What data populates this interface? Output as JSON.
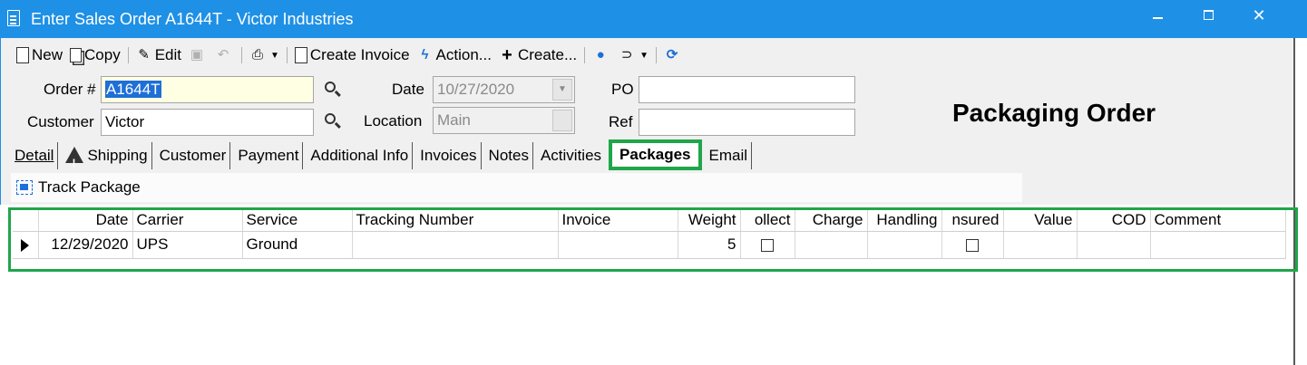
{
  "window": {
    "title": "Enter Sales Order A1644T - Victor Industries",
    "minimize_icon": "minimize-icon",
    "maximize_icon": "maximize-icon",
    "close_icon": "close-icon",
    "close_glyph": "✕",
    "accent_color": "#1e90e6"
  },
  "toolbar": {
    "new_label": "New",
    "copy_label": "Copy",
    "edit_label": "Edit",
    "create_invoice_label": "Create Invoice",
    "action_label": "Action...",
    "create_label": "Create...",
    "icons": [
      "new-document-icon",
      "copy-icon",
      "pencil-icon",
      "save-icon",
      "undo-icon",
      "printer-icon",
      "invoice-icon",
      "lightning-icon",
      "plus-icon",
      "contacts-icon",
      "paperclip-icon",
      "refresh-icon"
    ]
  },
  "form": {
    "order_label": "Order #",
    "order_value": "A1644T",
    "customer_label": "Customer",
    "customer_value": "Victor",
    "date_label": "Date",
    "date_value": "10/27/2020",
    "location_label": "Location",
    "location_value": "Main",
    "po_label": "PO",
    "po_value": "",
    "ref_label": "Ref",
    "ref_value": ""
  },
  "heading": "Packaging Order",
  "tabs": [
    {
      "label": "Detail",
      "active": false
    },
    {
      "label": "Shipping",
      "active": false,
      "icon": "warning-icon"
    },
    {
      "label": "Customer",
      "active": false
    },
    {
      "label": "Payment",
      "active": false
    },
    {
      "label": "Additional Info",
      "active": false
    },
    {
      "label": "Invoices",
      "active": false
    },
    {
      "label": "Notes",
      "active": false
    },
    {
      "label": "Activities",
      "active": false
    },
    {
      "label": "Packages",
      "active": true
    },
    {
      "label": "Email",
      "active": false
    }
  ],
  "subtoolbar": {
    "track_package_label": "Track Package"
  },
  "grid": {
    "columns": [
      "Date",
      "Carrier",
      "Service",
      "Tracking Number",
      "Invoice",
      "Weight",
      "Collect",
      "Charge",
      "Handling",
      "Insured",
      "Value",
      "COD",
      "Comment"
    ],
    "column_display": [
      "Date",
      "Carrier",
      "Service",
      "Tracking Number",
      "Invoice",
      "Weight",
      "ollect",
      "Charge",
      "Handling",
      "nsured",
      "Value",
      "COD",
      "Comment"
    ],
    "rows": [
      {
        "date": "12/29/2020",
        "carrier": "UPS",
        "service": "Ground",
        "tracking_number": "",
        "invoice": "",
        "weight": "5",
        "collect": false,
        "charge": "",
        "handling": "",
        "insured": false,
        "value": "",
        "cod": "",
        "comment": ""
      }
    ]
  },
  "highlight_color": "#1fa64a"
}
